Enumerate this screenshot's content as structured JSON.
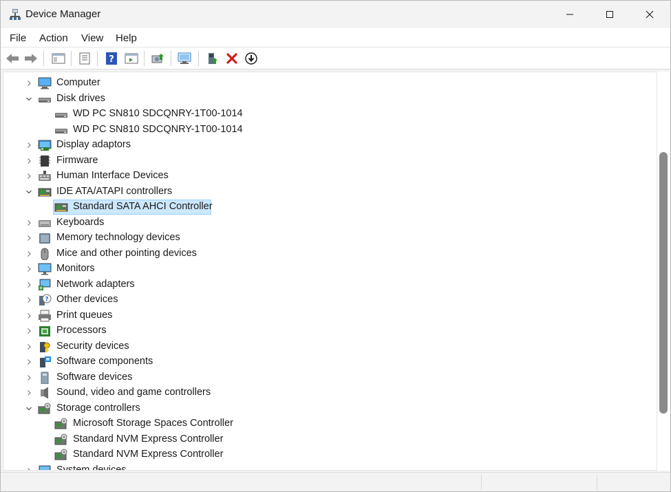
{
  "window": {
    "title": "Device Manager"
  },
  "menu": [
    "File",
    "Action",
    "View",
    "Help"
  ],
  "tree": [
    {
      "label": "Computer",
      "level": 0,
      "expanded": false,
      "icon": "computer-icon"
    },
    {
      "label": "Disk drives",
      "level": 0,
      "expanded": true,
      "icon": "disk-drive-icon"
    },
    {
      "label": "WD PC SN810 SDCQNRY-1T00-1014",
      "level": 1,
      "icon": "disk-drive-icon"
    },
    {
      "label": "WD PC SN810 SDCQNRY-1T00-1014",
      "level": 1,
      "icon": "disk-drive-icon"
    },
    {
      "label": "Display adaptors",
      "level": 0,
      "expanded": false,
      "icon": "display-adapter-icon"
    },
    {
      "label": "Firmware",
      "level": 0,
      "expanded": false,
      "icon": "firmware-icon"
    },
    {
      "label": "Human Interface Devices",
      "level": 0,
      "expanded": false,
      "icon": "hid-icon"
    },
    {
      "label": "IDE ATA/ATAPI controllers",
      "level": 0,
      "expanded": true,
      "icon": "ide-controller-icon"
    },
    {
      "label": "Standard SATA AHCI Controller",
      "level": 1,
      "selected": true,
      "icon": "ide-controller-icon"
    },
    {
      "label": "Keyboards",
      "level": 0,
      "expanded": false,
      "icon": "keyboard-icon"
    },
    {
      "label": "Memory technology devices",
      "level": 0,
      "expanded": false,
      "icon": "memory-device-icon"
    },
    {
      "label": "Mice and other pointing devices",
      "level": 0,
      "expanded": false,
      "icon": "mouse-icon"
    },
    {
      "label": "Monitors",
      "level": 0,
      "expanded": false,
      "icon": "monitor-icon"
    },
    {
      "label": "Network adapters",
      "level": 0,
      "expanded": false,
      "icon": "network-adapter-icon"
    },
    {
      "label": "Other devices",
      "level": 0,
      "expanded": false,
      "icon": "unknown-device-icon"
    },
    {
      "label": "Print queues",
      "level": 0,
      "expanded": false,
      "icon": "printer-icon"
    },
    {
      "label": "Processors",
      "level": 0,
      "expanded": false,
      "icon": "processor-icon"
    },
    {
      "label": "Security devices",
      "level": 0,
      "expanded": false,
      "icon": "security-device-icon"
    },
    {
      "label": "Software components",
      "level": 0,
      "expanded": false,
      "icon": "software-component-icon"
    },
    {
      "label": "Software devices",
      "level": 0,
      "expanded": false,
      "icon": "software-device-icon"
    },
    {
      "label": "Sound, video and game controllers",
      "level": 0,
      "expanded": false,
      "icon": "speaker-icon"
    },
    {
      "label": "Storage controllers",
      "level": 0,
      "expanded": true,
      "icon": "storage-controller-icon"
    },
    {
      "label": "Microsoft Storage Spaces Controller",
      "level": 1,
      "icon": "storage-controller-icon"
    },
    {
      "label": "Standard NVM Express Controller",
      "level": 1,
      "icon": "storage-controller-icon"
    },
    {
      "label": "Standard NVM Express Controller",
      "level": 1,
      "icon": "storage-controller-icon"
    },
    {
      "label": "System devices",
      "level": 0,
      "expanded": false,
      "icon": "system-device-icon"
    }
  ],
  "colors": {
    "selection_bg": "#cce8ff",
    "selection_border": "#99d1ff",
    "accent": "#0078d4"
  }
}
